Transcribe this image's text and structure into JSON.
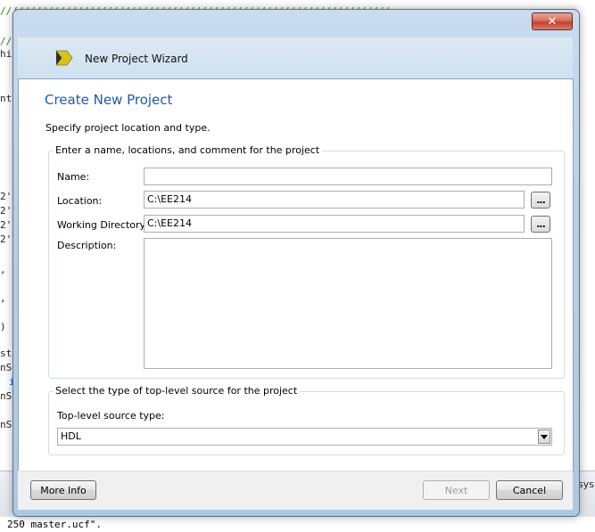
{
  "background_editor": {
    "lines": [
      "//////////////////////////////////////////////////////////////////",
      "//",
      "hi",
      "nt",
      "2'",
      "2'",
      "2'",
      "2'",
      ",",
      ",",
      ")",
      "st",
      "nS",
      "i",
      "nS",
      "nS"
    ],
    "status_text": "250 master.ucf\".",
    "side_text": "sys"
  },
  "window": {
    "title": "New Project Wizard",
    "close_glyph": "✕"
  },
  "page": {
    "title": "Create New Project",
    "subtitle": "Specify project location and type."
  },
  "project_group": {
    "legend": "Enter a name, locations, and comment for the project",
    "name_label": "Name:",
    "name_value": "",
    "location_label": "Location:",
    "location_value": "C:\\EE214",
    "workdir_label": "Working Directory:",
    "workdir_value": "C:\\EE214",
    "description_label": "Description:",
    "description_value": "",
    "browse_label": "..."
  },
  "source_group": {
    "legend": "Select the type of top-level source for the project",
    "type_label": "Top-level source type:",
    "type_value": "HDL"
  },
  "buttons": {
    "more_info": "More Info",
    "next": "Next",
    "cancel": "Cancel"
  },
  "colors": {
    "title_blue": "#1e5aa8",
    "frame": "#b8cfe6",
    "icon_yellow": "#d9c21c"
  }
}
